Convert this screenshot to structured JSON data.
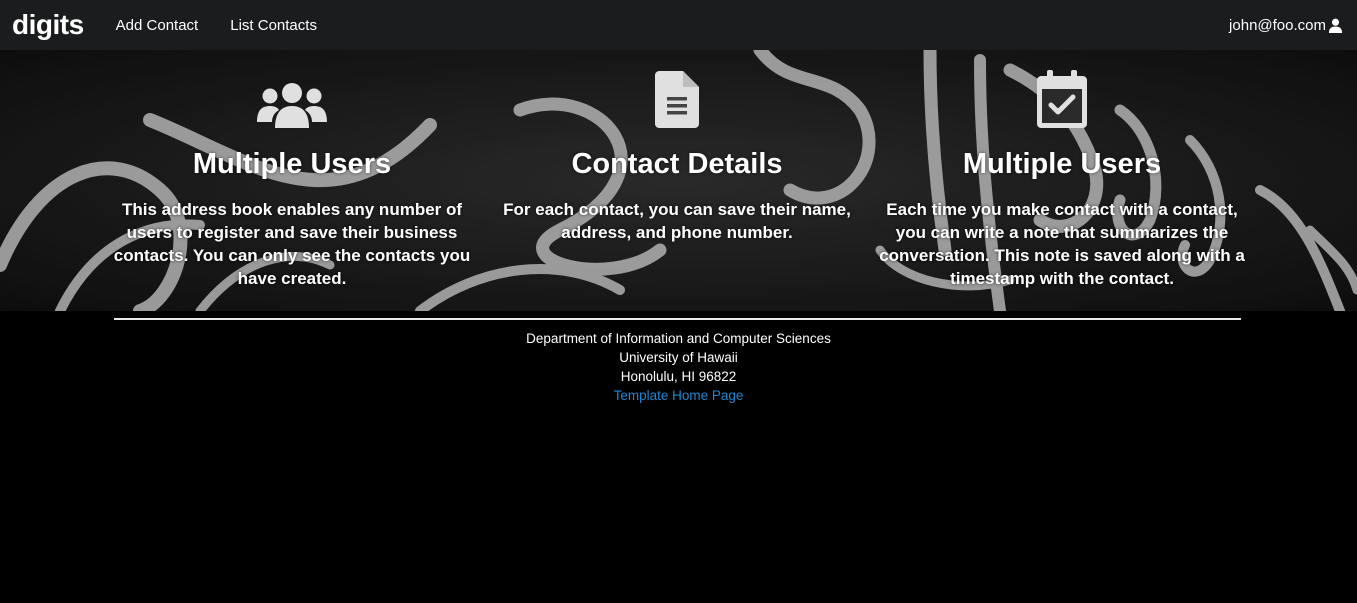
{
  "navbar": {
    "brand": "digits",
    "links": [
      "Add Contact",
      "List Contacts"
    ],
    "user": "john@foo.com",
    "user_icon": "user-icon"
  },
  "features": [
    {
      "icon": "users-icon",
      "title": "Multiple Users",
      "text": "This address book enables any number of users to register and save their business contacts. You can only see the contacts you have created."
    },
    {
      "icon": "file-text-icon",
      "title": "Contact Details",
      "text": "For each contact, you can save their name, address, and phone number."
    },
    {
      "icon": "calendar-check-icon",
      "title": "Multiple Users",
      "text": "Each time you make contact with a contact, you can write a note that summarizes the conversation. This note is saved along with a timestamp with the contact."
    }
  ],
  "footer": {
    "lines": [
      "Department of Information and Computer Sciences",
      "University of Hawaii",
      "Honolulu, HI 96822"
    ],
    "link": "Template Home Page"
  },
  "colors": {
    "navbar_bg": "#1b1c1d",
    "footer_bg": "#000000",
    "link": "#2185d0",
    "icon": "#e0e0e0"
  }
}
